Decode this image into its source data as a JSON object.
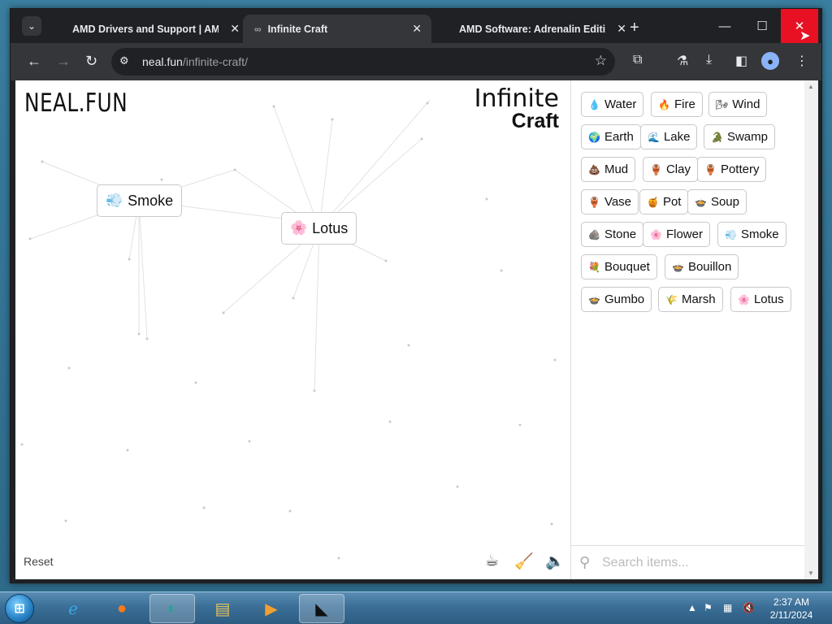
{
  "browser": {
    "tabs": [
      {
        "title": "AMD Drivers and Support | AMD",
        "close": "✕"
      },
      {
        "title": "Infinite Craft",
        "close": "✕"
      },
      {
        "title": "AMD Software: Adrenalin Edition",
        "close": "✕"
      }
    ],
    "new_tab": "+",
    "window_controls": {
      "minimize": "—",
      "maximize": "☐",
      "close": "✕"
    },
    "url_host": "neal.fun",
    "url_path": "/infinite-craft/"
  },
  "page": {
    "logo_left": "NEAL.FUN",
    "logo_right_line1": "Infinite",
    "logo_right_line2": "Craft",
    "reset_label": "Reset",
    "canvas_instances": [
      {
        "emoji": "💨",
        "label": "Smoke"
      },
      {
        "emoji": "🌸",
        "label": "Lotus"
      }
    ],
    "items": [
      {
        "emoji": "💧",
        "label": "Water"
      },
      {
        "emoji": "🔥",
        "label": "Fire"
      },
      {
        "emoji": "🌬",
        "label": "Wind"
      },
      {
        "emoji": "🌍",
        "label": "Earth"
      },
      {
        "emoji": "🌊",
        "label": "Lake"
      },
      {
        "emoji": "🐊",
        "label": "Swamp"
      },
      {
        "emoji": "💩",
        "label": "Mud"
      },
      {
        "emoji": "🏺",
        "label": "Clay"
      },
      {
        "emoji": "🏺",
        "label": "Pottery"
      },
      {
        "emoji": "🏺",
        "label": "Vase"
      },
      {
        "emoji": "🍯",
        "label": "Pot"
      },
      {
        "emoji": "🍲",
        "label": "Soup"
      },
      {
        "emoji": "🪨",
        "label": "Stone"
      },
      {
        "emoji": "🌸",
        "label": "Flower"
      },
      {
        "emoji": "💨",
        "label": "Smoke"
      },
      {
        "emoji": "💐",
        "label": "Bouquet"
      },
      {
        "emoji": "🍲",
        "label": "Bouillon"
      },
      {
        "emoji": "🍲",
        "label": "Gumbo"
      },
      {
        "emoji": "🌾",
        "label": "Marsh"
      },
      {
        "emoji": "🌸",
        "label": "Lotus"
      }
    ],
    "search_placeholder": "Search items..."
  },
  "taskbar": {
    "clock_time": "2:37 AM",
    "clock_date": "2/11/2024"
  }
}
